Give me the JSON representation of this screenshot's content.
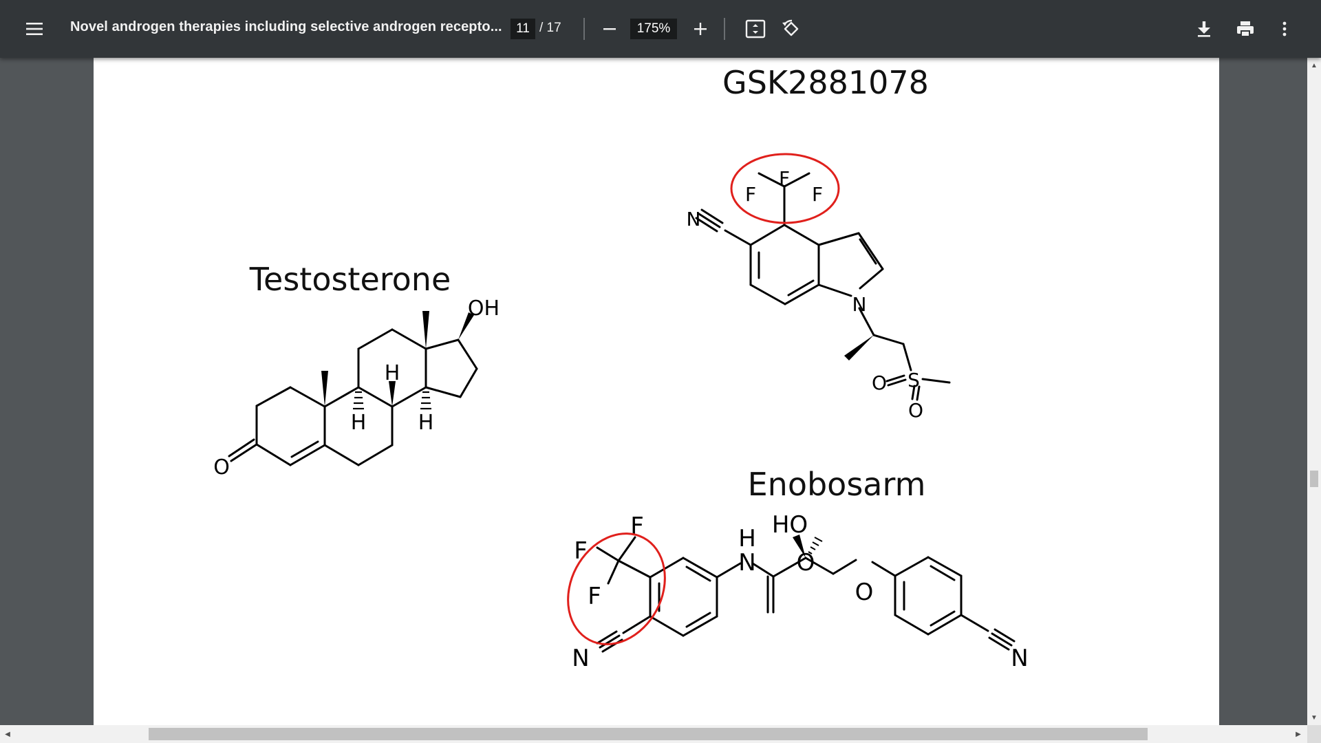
{
  "toolbar": {
    "title": "Novel androgen therapies including selective androgen recepto...",
    "page_current": "11",
    "page_total": "/ 17",
    "zoom": "175%",
    "icons": [
      "menu-icon",
      "zoom-out-icon",
      "zoom-in-icon",
      "fit-page-icon",
      "rotate-icon",
      "download-icon",
      "print-icon",
      "more-vert-icon"
    ]
  },
  "figure": {
    "gsk_title": "GSK2881078",
    "testosterone_title": "Testosterone",
    "enobosarm_title": "Enobosarm",
    "atoms": {
      "F": "F",
      "N": "N",
      "O": "O",
      "OH": "OH",
      "H": "H",
      "HO": "HO",
      "S": "S"
    },
    "highlight_color": "#e0201c"
  },
  "scrollbars": {
    "up": "▲",
    "down": "▼",
    "left": "◀",
    "right": "▶"
  }
}
